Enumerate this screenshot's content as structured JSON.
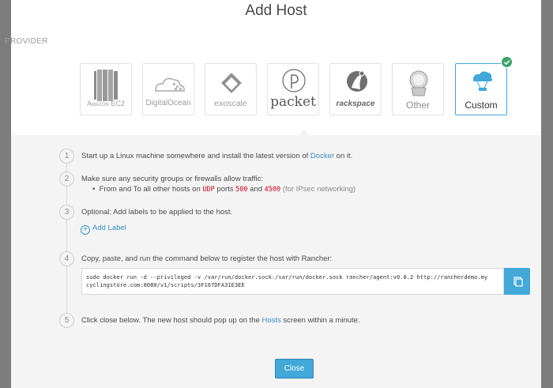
{
  "dialog": {
    "title": "Add Host",
    "provider_label": "PROVIDER"
  },
  "providers": [
    {
      "label": "Amazon EC2",
      "icon": "amazon-ec2-icon",
      "selected": false
    },
    {
      "label": "DigitalOcean",
      "icon": "digitalocean-icon",
      "selected": false
    },
    {
      "label": "exoscale",
      "icon": "exoscale-icon",
      "selected": false
    },
    {
      "label": "packet",
      "icon": "packet-icon",
      "selected": false
    },
    {
      "label": "rackspace",
      "icon": "rackspace-icon",
      "selected": false
    },
    {
      "label": "Other",
      "icon": "other-icon",
      "selected": false
    },
    {
      "label": "Custom",
      "icon": "custom-icon",
      "selected": true
    }
  ],
  "steps": [
    {
      "num": "1",
      "text_before": "Start up a Linux machine somewhere and install the latest version of ",
      "link": "Docker",
      "text_after": " on it."
    },
    {
      "num": "2",
      "text": "Make sure any security groups or firewalls allow traffic:",
      "bullet_before": "From and To all other hosts on ",
      "protocol": "UDP",
      "bullet_mid1": " ports ",
      "port1": "500",
      "bullet_mid2": " and ",
      "port2": "4500",
      "note": " (for IPsec networking)"
    },
    {
      "num": "3",
      "text": "Optional: Add labels to be applied to the host.",
      "add_label": "Add Label"
    },
    {
      "num": "4",
      "text": "Copy, paste, and run the command below to register the host with Rancher:",
      "command_line1": "sudo docker run -d --privileged -v /var/run/docker.sock:/var/run/docker.sock rancher/agent:v0.8.2 http://rancherdemo.my",
      "command_line2": "cyclingstore.com:8080/v1/scripts/3F167DFA31E3EE"
    },
    {
      "num": "5",
      "text_before": "Click close below. The new host should pop up on the ",
      "link": "Hosts",
      "text_after": " screen within a minute."
    }
  ],
  "buttons": {
    "close": "Close",
    "copy_icon": "copy-icon"
  },
  "colors": {
    "accent": "#41a8d8",
    "link": "#3b8ec6",
    "success": "#3ba36b",
    "port_red": "#d0021b"
  }
}
